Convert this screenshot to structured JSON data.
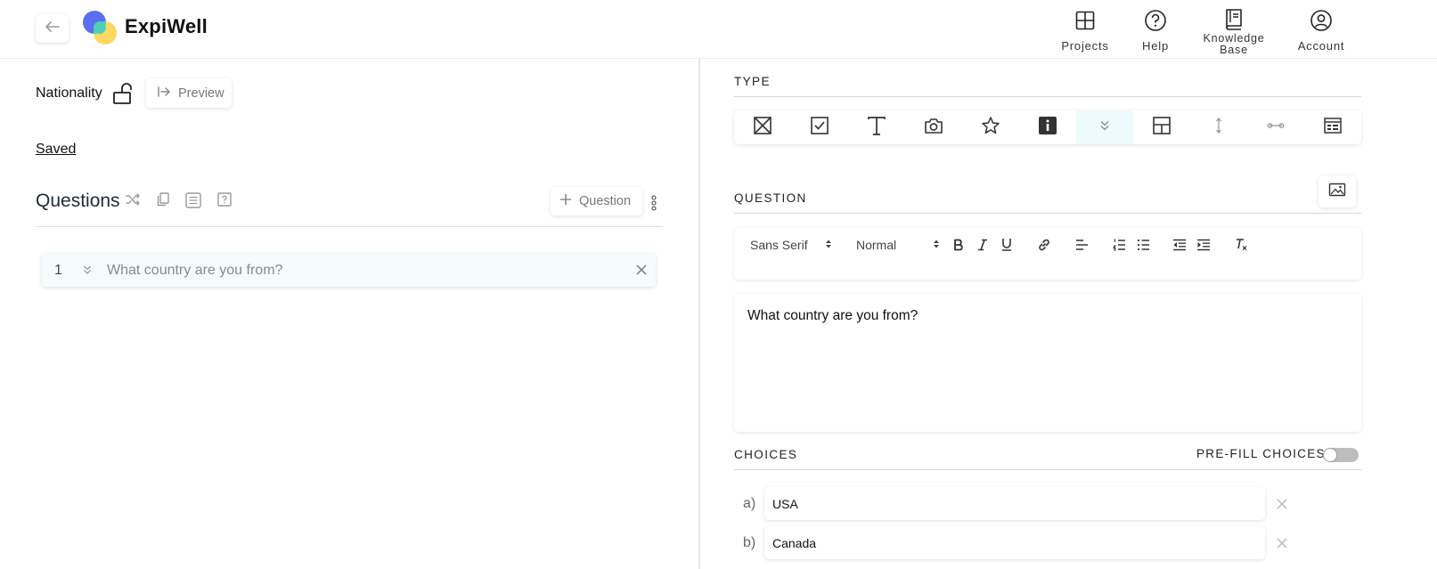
{
  "header": {
    "brand": "ExpiWell",
    "nav": [
      {
        "label": "Projects",
        "icon": "projects-grid-icon"
      },
      {
        "label": "Help",
        "icon": "help-circle-icon"
      },
      {
        "label_line1": "Knowledge",
        "label_line2": "Base",
        "icon": "book-icon"
      },
      {
        "label": "Account",
        "icon": "account-circle-icon"
      }
    ]
  },
  "left": {
    "survey_title": "Nationality",
    "preview_label": "Preview",
    "saved_label": "Saved",
    "questions_heading": "Questions",
    "add_question_label": "Question",
    "questions": [
      {
        "number": "1",
        "text": "What country are you from?"
      }
    ]
  },
  "right": {
    "type_heading": "TYPE",
    "type_icons": [
      "single-choice-icon",
      "checkbox-icon",
      "text-icon",
      "camera-icon",
      "star-icon",
      "info-icon",
      "dropdown-icon",
      "grid-icon",
      "vertical-slider-icon",
      "horizontal-slider-icon",
      "form-icon"
    ],
    "active_type": "dropdown-icon",
    "question_heading": "QUESTION",
    "font_family": "Sans Serif",
    "font_size": "Normal",
    "question_text": "What country are you from?",
    "choices_heading": "CHOICES",
    "prefill_label": "PRE-FILL CHOICES?",
    "prefill_enabled": false,
    "choices": [
      {
        "letter": "a)",
        "value": "USA"
      },
      {
        "letter": "b)",
        "value": "Canada"
      }
    ]
  },
  "colors": {
    "active_row_bg": "#f3fdfd",
    "logo_blue": "#5b6ef2",
    "logo_green": "#4cd1b6",
    "logo_yellow": "#ffd65a",
    "toggle_off": "#bdbdbd"
  }
}
